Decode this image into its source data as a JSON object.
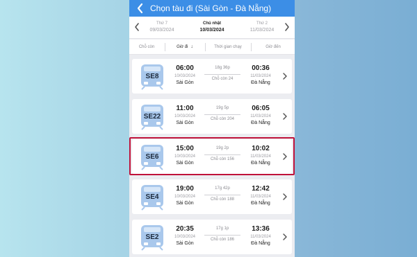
{
  "header": {
    "title": "Chọn tàu đi (Sài Gòn - Đà Nẵng)"
  },
  "dates": [
    {
      "day": "Thứ 7",
      "date": "09/03/2024",
      "active": false
    },
    {
      "day": "Chủ nhật",
      "date": "10/03/2024",
      "active": true
    },
    {
      "day": "Thứ 2",
      "date": "11/03/2024",
      "active": false
    }
  ],
  "sort": {
    "seats": "Chỗ còn",
    "departure": "Giờ đi",
    "duration": "Thời gian chạy",
    "arrival": "Giờ đến"
  },
  "trains": [
    {
      "name": "SE8",
      "dep_time": "06:00",
      "dep_date": "10/03/2024",
      "dep_station": "Sài Gòn",
      "duration": "18g 36p",
      "seats": "Chỗ còn 24",
      "arr_time": "00:36",
      "arr_date": "11/03/2024",
      "arr_station": "Đà Nẵng"
    },
    {
      "name": "SE22",
      "dep_time": "11:00",
      "dep_date": "10/03/2024",
      "dep_station": "Sài Gòn",
      "duration": "19g 5p",
      "seats": "Chỗ còn 204",
      "arr_time": "06:05",
      "arr_date": "11/03/2024",
      "arr_station": "Đà Nẵng"
    },
    {
      "name": "SE6",
      "dep_time": "15:00",
      "dep_date": "10/03/2024",
      "dep_station": "Sài Gòn",
      "duration": "19g 2p",
      "seats": "Chỗ còn 156",
      "arr_time": "10:02",
      "arr_date": "11/03/2024",
      "arr_station": "Đà Nẵng"
    },
    {
      "name": "SE4",
      "dep_time": "19:00",
      "dep_date": "10/03/2024",
      "dep_station": "Sài Gòn",
      "duration": "17g 42p",
      "seats": "Chỗ còn 188",
      "arr_time": "12:42",
      "arr_date": "11/03/2024",
      "arr_station": "Đà Nẵng"
    },
    {
      "name": "SE2",
      "dep_time": "20:35",
      "dep_date": "10/03/2024",
      "dep_station": "Sài Gòn",
      "duration": "17g 1p",
      "seats": "Chỗ còn 186",
      "arr_time": "13:36",
      "arr_date": "11/03/2024",
      "arr_station": "Đà Nẵng"
    }
  ],
  "colors": {
    "header": "#3c8ee6",
    "train_badge": "#a9c8ec",
    "highlight": "#c0123a"
  }
}
